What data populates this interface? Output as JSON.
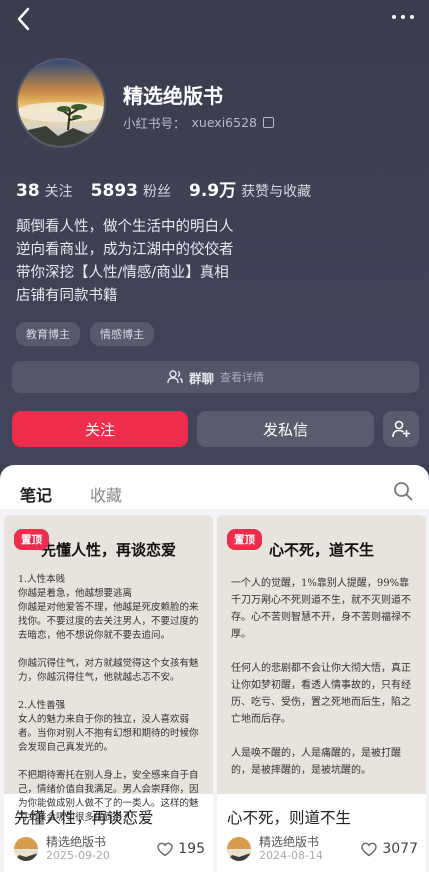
{
  "header": {
    "back_icon": "chevron-left-icon",
    "more_icon": "more-dots-icon"
  },
  "profile": {
    "name": "精选绝版书",
    "id_label": "小红书号：",
    "id_value": "xuexi6528",
    "stats": [
      {
        "num": "38",
        "label": "关注"
      },
      {
        "num": "5893",
        "label": "粉丝"
      },
      {
        "num": "9.9万",
        "label": "获赞与收藏"
      }
    ],
    "bio": [
      "颠倒看人性，做个生活中的明白人",
      "逆向看商业，成为江湖中的佼佼者",
      "带你深挖【人性/情感/商业】真相",
      "店铺有同款书籍"
    ],
    "tags": [
      "教育博主",
      "情感博主"
    ],
    "group": {
      "label": "群聊",
      "sub": "查看详情"
    }
  },
  "actions": {
    "follow": "关注",
    "message": "发私信",
    "add_icon": "add-user-icon"
  },
  "accent": "#ee2c4b",
  "tabs": [
    "笔记",
    "收藏"
  ],
  "notes": [
    {
      "pin": "置顶",
      "cover_title": "先懂人性，再谈恋爱",
      "cover_body": "1.人性本贱\n你越是着急，他越想要逃离\n你越是对他爱答不理，他越是死皮赖脸的来找你。不要过度的去关注男人，不要过度的去暗恋，他不想说你就不要去追问。\n\n你越沉得住气，对方就越觉得这个女孩有魅力，你越沉得住气，他就越忐忑不安。\n\n2.人性善强\n女人的魅力来自于你的独立，没人喜欢弱者。当你对别人不抱有幻想和期待的时候你会发现自己真发光的。\n\n不把期待寄托在别人身上，安全感来自于自己，情绪价值自我满足。男人会崇拜你，因为你能做成别人做不了的一类人。这样的魅力女孩会吸引很多优质男人",
      "title": "先懂人性，再谈恋爱",
      "author": "精选绝版书",
      "date": "2025-09-20",
      "likes": "195"
    },
    {
      "pin": "置顶",
      "cover_title": "心不死，道不生",
      "cover_body": "一个人的觉醒，1%靠别人提醒，99%靠千刀万剐心不死则道不生，就不灭则道不存。心不苦则智慧不开，身不苦则福禄不厚。\n\n任何人的悲剧都不会让你大彻大悟，真正让你如梦初醒，看透人情事故的，只有经历、吃亏、受伤，置之死地而后生，陷之亡地而后存。\n\n人是唤不醒的，人是痛醒的，是被打醒的，是被摔醒的，是被坑醒的。",
      "title": "心不死，则道不生",
      "author": "精选绝版书",
      "date": "2024-08-14",
      "likes": "3077"
    }
  ]
}
